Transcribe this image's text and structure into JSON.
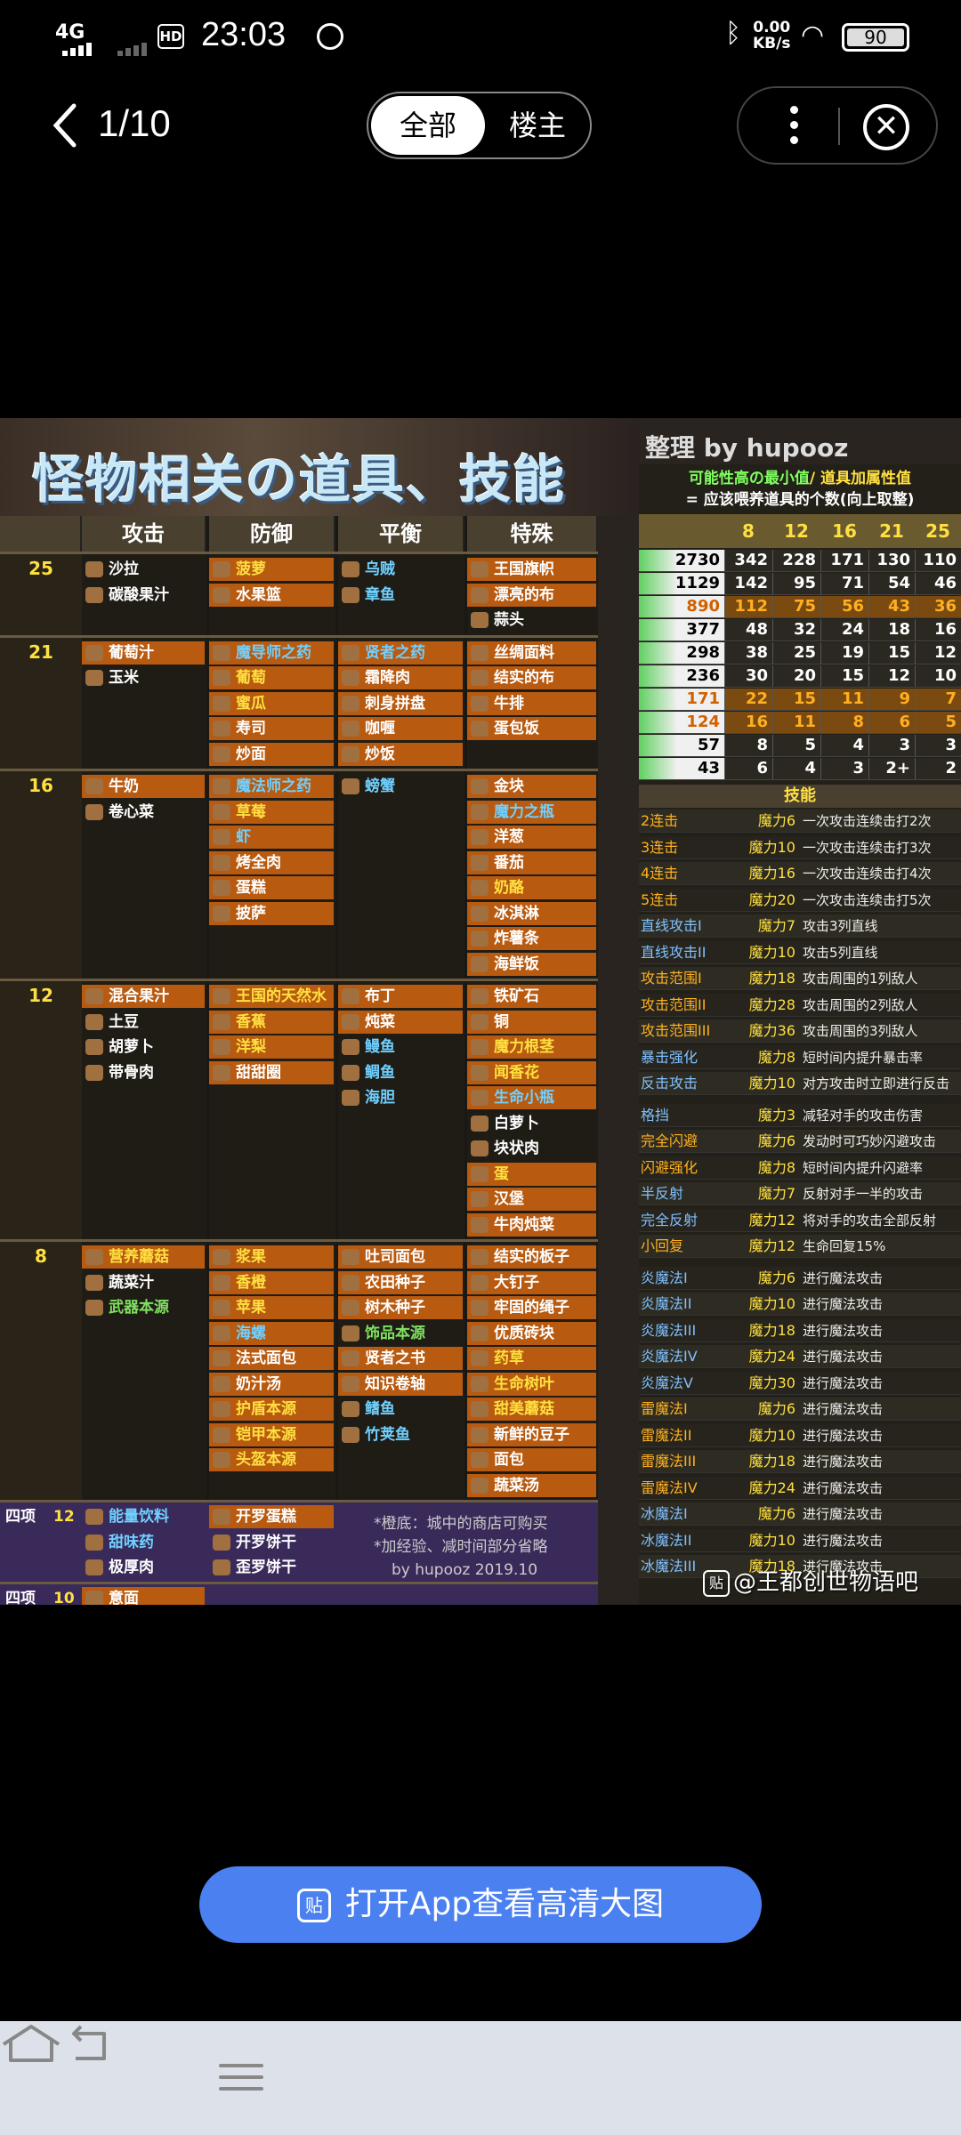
{
  "status": {
    "network": "4G",
    "hd": "HD",
    "time": "23:03",
    "speed_value": "0.00",
    "speed_unit": "KB/s",
    "battery": "90"
  },
  "nav": {
    "counter": "1/10",
    "seg_all": "全部",
    "seg_op": "楼主"
  },
  "image": {
    "title": "怪物相关の道具、技能",
    "credit": "整理 by hupooz 2019.10",
    "headers": [
      "攻击",
      "防御",
      "平衡",
      "特殊"
    ],
    "groups": [
      {
        "level": "25",
        "rows": [
          [
            "沙拉",
            "菠萝",
            "乌贼",
            "王国旗帜"
          ],
          [
            "碳酸果汁",
            "水果篮",
            "章鱼",
            "漂亮的布"
          ],
          [
            "",
            "",
            "",
            "蒜头"
          ]
        ]
      },
      {
        "level": "21",
        "rows": [
          [
            "葡萄汁",
            "魔导师之药",
            "贤者之药",
            "丝绸面料"
          ],
          [
            "玉米",
            "葡萄",
            "霜降肉",
            "结实的布"
          ],
          [
            "",
            "蜜瓜",
            "刺身拼盘",
            "牛排"
          ],
          [
            "",
            "寿司",
            "咖喱",
            "蛋包饭"
          ],
          [
            "",
            "炒面",
            "炒饭",
            ""
          ]
        ]
      },
      {
        "level": "16",
        "rows": [
          [
            "牛奶",
            "魔法师之药",
            "螃蟹",
            "金块"
          ],
          [
            "卷心菜",
            "草莓",
            "",
            "魔力之瓶"
          ],
          [
            "",
            "虾",
            "",
            "洋葱"
          ],
          [
            "",
            "烤全肉",
            "",
            "番茄"
          ],
          [
            "",
            "蛋糕",
            "",
            "奶酪"
          ],
          [
            "",
            "披萨",
            "",
            "冰淇淋"
          ],
          [
            "",
            "",
            "",
            "炸薯条"
          ],
          [
            "",
            "",
            "",
            "海鲜饭"
          ]
        ]
      },
      {
        "level": "12",
        "rows": [
          [
            "混合果汁",
            "王国的天然水",
            "布丁",
            "铁矿石"
          ],
          [
            "土豆",
            "香蕉",
            "炖菜",
            "铜"
          ],
          [
            "胡萝卜",
            "洋梨",
            "鳗鱼",
            "魔力根茎"
          ],
          [
            "带骨肉",
            "甜甜圈",
            "鲷鱼",
            "闻香花"
          ],
          [
            "",
            "",
            "海胆",
            "生命小瓶"
          ],
          [
            "",
            "",
            "",
            "白萝卜"
          ],
          [
            "",
            "",
            "",
            "块状肉"
          ],
          [
            "",
            "",
            "",
            "蛋"
          ],
          [
            "",
            "",
            "",
            "汉堡"
          ],
          [
            "",
            "",
            "",
            "牛肉炖菜"
          ]
        ]
      },
      {
        "level": "8",
        "rows": [
          [
            "营养蘑菇",
            "浆果",
            "吐司面包",
            "结实的板子"
          ],
          [
            "蔬菜汁",
            "香橙",
            "农田种子",
            "大钉子"
          ],
          [
            "武器本源",
            "苹果",
            "树木种子",
            "牢固的绳子"
          ],
          [
            "",
            "海螺",
            "饰品本源",
            "优质砖块"
          ],
          [
            "",
            "法式面包",
            "贤者之书",
            "药草"
          ],
          [
            "",
            "奶汁汤",
            "知识卷轴",
            "生命树叶"
          ],
          [
            "",
            "护盾本源",
            "鳍鱼",
            "甜美蘑菇"
          ],
          [
            "",
            "铠甲本源",
            "竹荚鱼",
            "新鲜的豆子"
          ],
          [
            "",
            "头盔本源",
            "",
            "面包"
          ],
          [
            "",
            "",
            "",
            "蔬菜汤"
          ]
        ]
      }
    ],
    "four_a": {
      "label": "四项",
      "level": "12",
      "rows": [
        [
          "能量饮料",
          "开罗蛋糕"
        ],
        [
          "甜味药",
          "开罗饼干"
        ],
        [
          "极厚肉",
          "歪罗饼干"
        ]
      ]
    },
    "four_b": {
      "label": "四项",
      "level": "10",
      "rows": [
        [
          "意面",
          ""
        ]
      ]
    },
    "note1": "*橙底：城中的商店可购买",
    "note2": "*加经验、减时间部分省略",
    "note3": "by hupooz 2019.10",
    "right_sub1a": "可能性高の最小值",
    "right_sub1b": "/ 道具加属性值",
    "right_sub2": "= 应该喂养道具的个数(向上取整)",
    "right_cols": [
      "8",
      "12",
      "16",
      "21",
      "25"
    ],
    "numbers": [
      [
        "2730",
        "342",
        "228",
        "171",
        "130",
        "110"
      ],
      [
        "1129",
        "142",
        "95",
        "71",
        "54",
        "46"
      ],
      [
        "890",
        "112",
        "75",
        "56",
        "43",
        "36"
      ],
      [
        "377",
        "48",
        "32",
        "24",
        "18",
        "16"
      ],
      [
        "298",
        "38",
        "25",
        "19",
        "15",
        "12"
      ],
      [
        "236",
        "30",
        "20",
        "15",
        "12",
        "10"
      ],
      [
        "171",
        "22",
        "15",
        "11",
        "9",
        "7"
      ],
      [
        "124",
        "16",
        "11",
        "8",
        "6",
        "5"
      ],
      [
        "57",
        "8",
        "5",
        "4",
        "3",
        "3"
      ],
      [
        "43",
        "6",
        "4",
        "3",
        "2+",
        "2"
      ]
    ],
    "skills_title": "技能",
    "skills": [
      [
        "2连击",
        "魔力6",
        "一次攻击连续击打2次"
      ],
      [
        "3连击",
        "魔力10",
        "一次攻击连续击打3次"
      ],
      [
        "4连击",
        "魔力16",
        "一次攻击连续击打4次"
      ],
      [
        "5连击",
        "魔力20",
        "一次攻击连续击打5次"
      ],
      [
        "直线攻击I",
        "魔力7",
        "攻击3列直线"
      ],
      [
        "直线攻击II",
        "魔力10",
        "攻击5列直线"
      ],
      [
        "攻击范围I",
        "魔力18",
        "攻击周围的1列敌人"
      ],
      [
        "攻击范围II",
        "魔力28",
        "攻击周围的2列敌人"
      ],
      [
        "攻击范围III",
        "魔力36",
        "攻击周围的3列敌人"
      ],
      [
        "暴击强化",
        "魔力8",
        "短时间内提升暴击率"
      ],
      [
        "反击攻击",
        "魔力10",
        "对方攻击时立即进行反击"
      ],
      [
        "格挡",
        "魔力3",
        "减轻对手的攻击伤害"
      ],
      [
        "完全闪避",
        "魔力6",
        "发动时可巧妙闪避攻击"
      ],
      [
        "闪避强化",
        "魔力8",
        "短时间内提升闪避率"
      ],
      [
        "半反射",
        "魔力7",
        "反射对手一半的攻击"
      ],
      [
        "完全反射",
        "魔力12",
        "将对手的攻击全部反射"
      ],
      [
        "小回复",
        "魔力12",
        "生命回复15%"
      ],
      [
        "炎魔法I",
        "魔力6",
        "进行魔法攻击"
      ],
      [
        "炎魔法II",
        "魔力10",
        "进行魔法攻击"
      ],
      [
        "炎魔法III",
        "魔力18",
        "进行魔法攻击"
      ],
      [
        "炎魔法IV",
        "魔力24",
        "进行魔法攻击"
      ],
      [
        "炎魔法V",
        "魔力30",
        "进行魔法攻击"
      ],
      [
        "雷魔法I",
        "魔力6",
        "进行魔法攻击"
      ],
      [
        "雷魔法II",
        "魔力10",
        "进行魔法攻击"
      ],
      [
        "雷魔法III",
        "魔力18",
        "进行魔法攻击"
      ],
      [
        "雷魔法IV",
        "魔力24",
        "进行魔法攻击"
      ],
      [
        "冰魔法I",
        "魔力6",
        "进行魔法攻击"
      ],
      [
        "冰魔法II",
        "魔力10",
        "进行魔法攻击"
      ],
      [
        "冰魔法III",
        "魔力18",
        "进行魔法攻击"
      ]
    ],
    "watermark": "@王都创世物语吧",
    "watermark_icon": "贴"
  },
  "open_app": {
    "label": "打开App查看高清大图",
    "icon": "贴"
  },
  "icons": {
    "back": "chevron-left-icon",
    "more": "more-vertical-icon",
    "close": "close-circle-icon"
  }
}
